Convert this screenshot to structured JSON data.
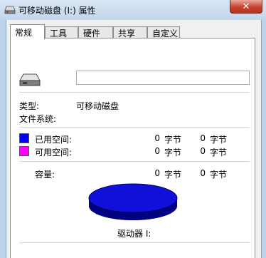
{
  "window": {
    "title": "可移动磁盘 (I:) 属性",
    "close_label": "✕"
  },
  "tabs": [
    {
      "label": "常规",
      "active": true
    },
    {
      "label": "工具",
      "active": false
    },
    {
      "label": "硬件",
      "active": false
    },
    {
      "label": "共享",
      "active": false
    },
    {
      "label": "自定义",
      "active": false
    }
  ],
  "general": {
    "volume_name": "",
    "type_label": "类型:",
    "type_value": "可移动磁盘",
    "fs_label": "文件系统:",
    "fs_value": "",
    "used_label": "已用空间:",
    "used_bytes": "0",
    "used_unit": "字节",
    "used_size": "0",
    "used_size_unit": "字节",
    "free_label": "可用空间:",
    "free_bytes": "0",
    "free_unit": "字节",
    "free_size": "0",
    "free_size_unit": "字节",
    "capacity_label": "容量:",
    "capacity_bytes": "0",
    "capacity_unit": "字节",
    "capacity_size": "0",
    "capacity_size_unit": "字节",
    "drive_label": "驱动器 I:"
  },
  "colors": {
    "used": "#0000ff",
    "free": "#ff00ff",
    "pie_top": "#1010d8",
    "pie_side": "#000080"
  }
}
